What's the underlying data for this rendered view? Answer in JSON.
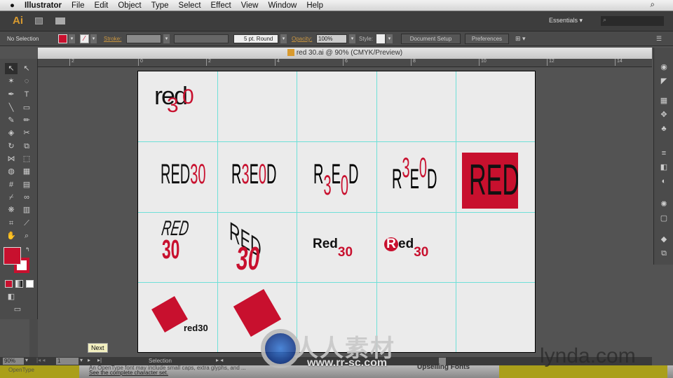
{
  "menubar": {
    "app": "Illustrator",
    "items": [
      "File",
      "Edit",
      "Object",
      "Type",
      "Select",
      "Effect",
      "View",
      "Window",
      "Help"
    ]
  },
  "appbar": {
    "logo": "Ai",
    "workspace": "Essentials ▾",
    "search_placeholder": ""
  },
  "control": {
    "selection": "No Selection",
    "stroke_label": "Stroke:",
    "brush": "5 pt. Round",
    "opacity_label": "Opacity:",
    "opacity": "100%",
    "style_label": "Style:",
    "document_setup": "Document Setup",
    "preferences": "Preferences"
  },
  "document": {
    "title": "red 30.ai @ 90% (CMYK/Preview)"
  },
  "ruler": [
    "2",
    "0",
    "2",
    "4",
    "6",
    "8",
    "10",
    "12",
    "14"
  ],
  "colors": {
    "accent": "#c8102e",
    "guide": "#6fe0d8",
    "artboard": "#ebebeb",
    "canvas": "#535353"
  },
  "logos": {
    "c1": {
      "a": "re",
      "b": "d",
      "n": "3",
      "o": "0"
    },
    "c2": {
      "a": "RED",
      "b": "30"
    },
    "c3": {
      "a": "R",
      "b": "3",
      "c": "E",
      "d": "0",
      "e": "D"
    },
    "c6": "RED",
    "c7": "RED",
    "c8": "30",
    "c9": "Red",
    "c10": "30",
    "c11": "R",
    "c12": "ed",
    "c13": "30",
    "c14": "red30"
  },
  "status": {
    "zoom": "90%",
    "artboard": "1",
    "tool": "Selection",
    "tooltip": "Next"
  },
  "caption": {
    "left": "OpenType",
    "line1": "An OpenType font may include small caps, extra glyphs, and ...",
    "line2": "See the complete character set.",
    "right": "Upselling Fonts"
  },
  "watermarks": {
    "lynda": "lynda.com",
    "site": "www.rr-sc.com",
    "cn": "人人素材"
  }
}
